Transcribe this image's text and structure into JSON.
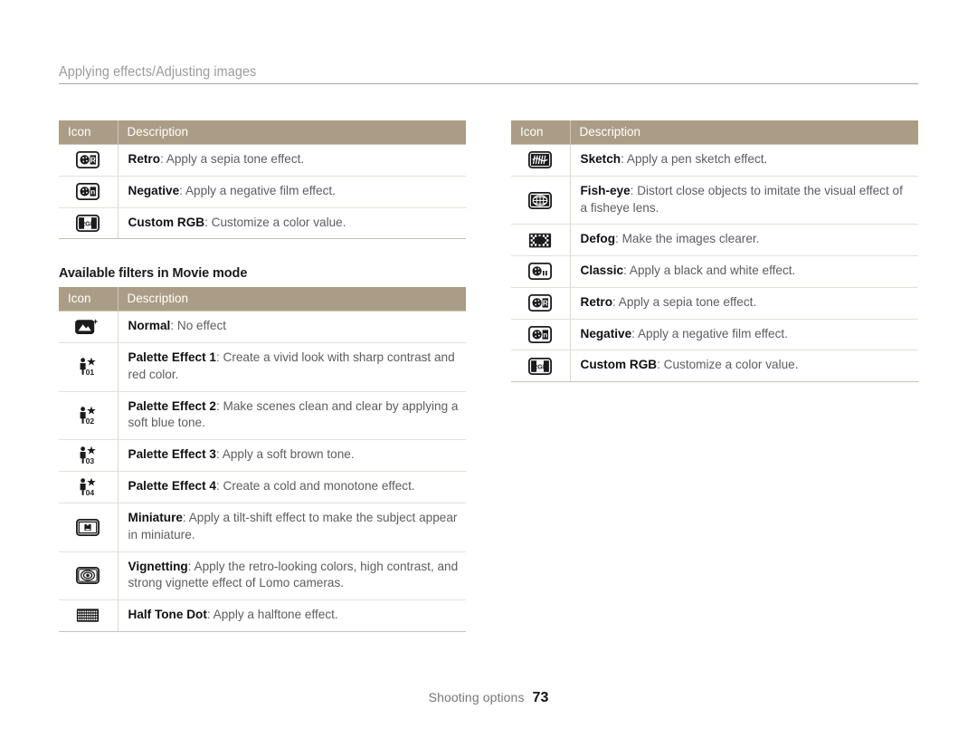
{
  "running_head": {
    "title": "Applying effects/Adjusting images"
  },
  "columns": {
    "left": {
      "table_top": {
        "headers": {
          "icon": "Icon",
          "description": "Description"
        },
        "rows": [
          {
            "icon": "retro-filter-icon",
            "term": "Retro",
            "rest": ": Apply a sepia tone effect."
          },
          {
            "icon": "negative-filter-icon",
            "term": "Negative",
            "rest": ": Apply a negative film effect."
          },
          {
            "icon": "custom-rgb-filter-icon",
            "term": "Custom RGB",
            "rest": ": Customize a color value."
          }
        ]
      },
      "section_heading": "Available filters in Movie mode",
      "table_movie": {
        "headers": {
          "icon": "Icon",
          "description": "Description"
        },
        "rows": [
          {
            "icon": "normal-filter-icon",
            "term": "Normal",
            "rest": ": No effect"
          },
          {
            "icon": "palette-effect-1-icon",
            "term": "Palette Effect 1",
            "rest": ": Create a vivid look with sharp contrast and red color."
          },
          {
            "icon": "palette-effect-2-icon",
            "term": "Palette Effect 2",
            "rest": ": Make scenes clean and clear by applying a soft blue tone."
          },
          {
            "icon": "palette-effect-3-icon",
            "term": "Palette Effect 3",
            "rest": ": Apply a soft brown tone."
          },
          {
            "icon": "palette-effect-4-icon",
            "term": "Palette Effect 4",
            "rest": ": Create a cold and monotone effect."
          },
          {
            "icon": "miniature-filter-icon",
            "term": "Miniature",
            "rest": ": Apply a tilt-shift effect to make the subject appear in miniature."
          },
          {
            "icon": "vignetting-filter-icon",
            "term": "Vignetting",
            "rest": ": Apply the retro-looking colors, high contrast, and strong vignette effect of Lomo cameras."
          },
          {
            "icon": "half-tone-dot-filter-icon",
            "term": "Half Tone Dot",
            "rest": ": Apply a halftone effect."
          }
        ]
      }
    },
    "right": {
      "table_top": {
        "headers": {
          "icon": "Icon",
          "description": "Description"
        },
        "rows": [
          {
            "icon": "sketch-filter-icon",
            "term": "Sketch",
            "rest": ": Apply a pen sketch effect."
          },
          {
            "icon": "fish-eye-filter-icon",
            "term": "Fish-eye",
            "rest": ": Distort close objects to imitate the visual effect of a fisheye lens."
          },
          {
            "icon": "defog-filter-icon",
            "term": "Defog",
            "rest": ": Make the images clearer."
          },
          {
            "icon": "classic-filter-icon",
            "term": "Classic",
            "rest": ": Apply a black and white effect."
          },
          {
            "icon": "retro-filter-icon",
            "term": "Retro",
            "rest": ": Apply a sepia tone effect."
          },
          {
            "icon": "negative-filter-icon",
            "term": "Negative",
            "rest": ": Apply a negative film effect."
          },
          {
            "icon": "custom-rgb-filter-icon",
            "term": "Custom RGB",
            "rest": ": Customize a color value."
          }
        ]
      }
    }
  },
  "footer": {
    "label": "Shooting options",
    "page_number": "73"
  },
  "colors": {
    "table_header_bg": "#ab9d85",
    "table_header_text": "#ffffff",
    "rule": "#a8a8a8",
    "body_text": "#5d5d5d",
    "term_text": "#111111"
  }
}
